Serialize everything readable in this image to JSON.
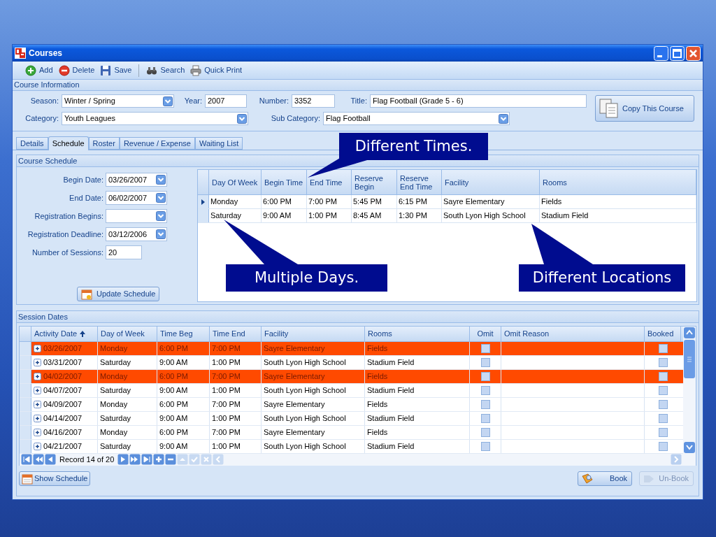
{
  "window": {
    "title": "Courses"
  },
  "toolbar": {
    "groups": [
      {
        "items": [
          {
            "kind": "add",
            "label": "Add"
          },
          {
            "kind": "delete",
            "label": "Delete"
          },
          {
            "kind": "save",
            "label": "Save"
          }
        ]
      },
      {
        "items": [
          {
            "kind": "search",
            "label": "Search"
          },
          {
            "kind": "print",
            "label": "Quick Print"
          }
        ]
      }
    ]
  },
  "course_information": {
    "heading": "Course Information",
    "season": {
      "label": "Season:",
      "value": "Winter / Spring"
    },
    "year": {
      "label": "Year:",
      "value": "2007"
    },
    "number": {
      "label": "Number:",
      "value": "3352"
    },
    "title": {
      "label": "Title:",
      "value": "Flag Football (Grade 5 - 6)"
    },
    "category": {
      "label": "Category:",
      "value": "Youth Leagues"
    },
    "sub_category": {
      "label": "Sub Category:",
      "value": "Flag Football"
    },
    "copy_button": "Copy This Course"
  },
  "tabs": [
    {
      "label": "Details",
      "selected": false
    },
    {
      "label": "Schedule",
      "selected": true
    },
    {
      "label": "Roster",
      "selected": false
    },
    {
      "label": "Revenue / Expense",
      "selected": false
    },
    {
      "label": "Waiting List",
      "selected": false
    }
  ],
  "course_schedule": {
    "heading": "Course Schedule",
    "fields": [
      {
        "kind": "date",
        "label": "Begin Date:",
        "value": "03/26/2007"
      },
      {
        "kind": "date",
        "label": "End Date:",
        "value": "06/02/2007"
      },
      {
        "kind": "date",
        "label": "Registration Begins:"
      },
      {
        "kind": "date",
        "label": "Registration Deadline:",
        "value": "03/12/2006"
      },
      {
        "kind": "text",
        "label": "Number of Sessions:",
        "value": "20"
      }
    ],
    "update_button": "Update Schedule",
    "grid": {
      "columns": [
        "Day Of Week",
        "Begin Time",
        "End Time",
        "Reserve Begin",
        "Reserve End Time",
        "Facility",
        "Rooms"
      ],
      "rows": [
        {
          "selected": true,
          "cells": [
            "Monday",
            "6:00 PM",
            "7:00 PM",
            "5:45 PM",
            "6:15 PM",
            "Sayre Elementary",
            "Fields"
          ]
        },
        {
          "selected": false,
          "cells": [
            "Saturday",
            "9:00 AM",
            "1:00 PM",
            "8:45 AM",
            "1:30 PM",
            "South Lyon High School",
            "Stadium Field"
          ]
        }
      ]
    }
  },
  "session_dates": {
    "heading": "Session Dates",
    "columns": [
      {
        "label": "Activity Date",
        "sorted": true
      },
      {
        "label": "Day of Week",
        "sorted": false
      },
      {
        "label": "Time Beg",
        "sorted": false
      },
      {
        "label": "Time End",
        "sorted": false
      },
      {
        "label": "Facility",
        "sorted": false
      },
      {
        "label": "Rooms",
        "sorted": false
      },
      {
        "label": "Omit",
        "sorted": false
      },
      {
        "label": "Omit Reason",
        "sorted": false
      },
      {
        "label": "Booked",
        "sorted": false
      }
    ],
    "rows": [
      {
        "highlighted": true,
        "expanded": false,
        "cells": [
          "03/26/2007",
          "Monday",
          "6:00 PM",
          "7:00 PM",
          "Sayre Elementary",
          "Fields"
        ],
        "omit": false,
        "booked": false
      },
      {
        "highlighted": false,
        "expanded": false,
        "cells": [
          "03/31/2007",
          "Saturday",
          "9:00 AM",
          "1:00 PM",
          "South Lyon High School",
          "Stadium Field"
        ],
        "omit": false,
        "booked": false
      },
      {
        "highlighted": true,
        "expanded": false,
        "cells": [
          "04/02/2007",
          "Monday",
          "6:00 PM",
          "7:00 PM",
          "Sayre Elementary",
          "Fields"
        ],
        "omit": false,
        "booked": false
      },
      {
        "highlighted": false,
        "expanded": false,
        "cells": [
          "04/07/2007",
          "Saturday",
          "9:00 AM",
          "1:00 PM",
          "South Lyon High School",
          "Stadium Field"
        ],
        "omit": false,
        "booked": false
      },
      {
        "highlighted": false,
        "expanded": false,
        "cells": [
          "04/09/2007",
          "Monday",
          "6:00 PM",
          "7:00 PM",
          "Sayre Elementary",
          "Fields"
        ],
        "omit": false,
        "booked": false
      },
      {
        "highlighted": false,
        "expanded": false,
        "cells": [
          "04/14/2007",
          "Saturday",
          "9:00 AM",
          "1:00 PM",
          "South Lyon High School",
          "Stadium Field"
        ],
        "omit": false,
        "booked": false
      },
      {
        "highlighted": false,
        "expanded": false,
        "cells": [
          "04/16/2007",
          "Monday",
          "6:00 PM",
          "7:00 PM",
          "Sayre Elementary",
          "Fields"
        ],
        "omit": false,
        "booked": false
      },
      {
        "highlighted": false,
        "expanded": false,
        "cells": [
          "04/21/2007",
          "Saturday",
          "9:00 AM",
          "1:00 PM",
          "South Lyon High School",
          "Stadium Field"
        ],
        "omit": false,
        "booked": false
      }
    ],
    "navigator": {
      "record_text": "Record 14 of 20",
      "before": [
        {
          "kind": "first",
          "disabled": false
        },
        {
          "kind": "prev_page",
          "disabled": false
        },
        {
          "kind": "prev",
          "disabled": false
        }
      ],
      "after": [
        {
          "kind": "next",
          "disabled": false
        },
        {
          "kind": "next_page",
          "disabled": false
        },
        {
          "kind": "last",
          "disabled": false
        },
        {
          "kind": "add",
          "disabled": false
        },
        {
          "kind": "remove",
          "disabled": false
        },
        {
          "kind": "up",
          "disabled": true
        },
        {
          "kind": "check",
          "disabled": true
        },
        {
          "kind": "cancel",
          "disabled": true
        },
        {
          "kind": "back",
          "disabled": true
        }
      ]
    },
    "show_schedule_button": "Show Schedule",
    "book_button": {
      "label": "Book",
      "disabled": false
    },
    "unbook_button": {
      "label": "Un-Book",
      "disabled": true
    }
  },
  "callouts": [
    {
      "text": "Different Times."
    },
    {
      "text": "Multiple Days."
    },
    {
      "text": "Different Locations"
    }
  ]
}
